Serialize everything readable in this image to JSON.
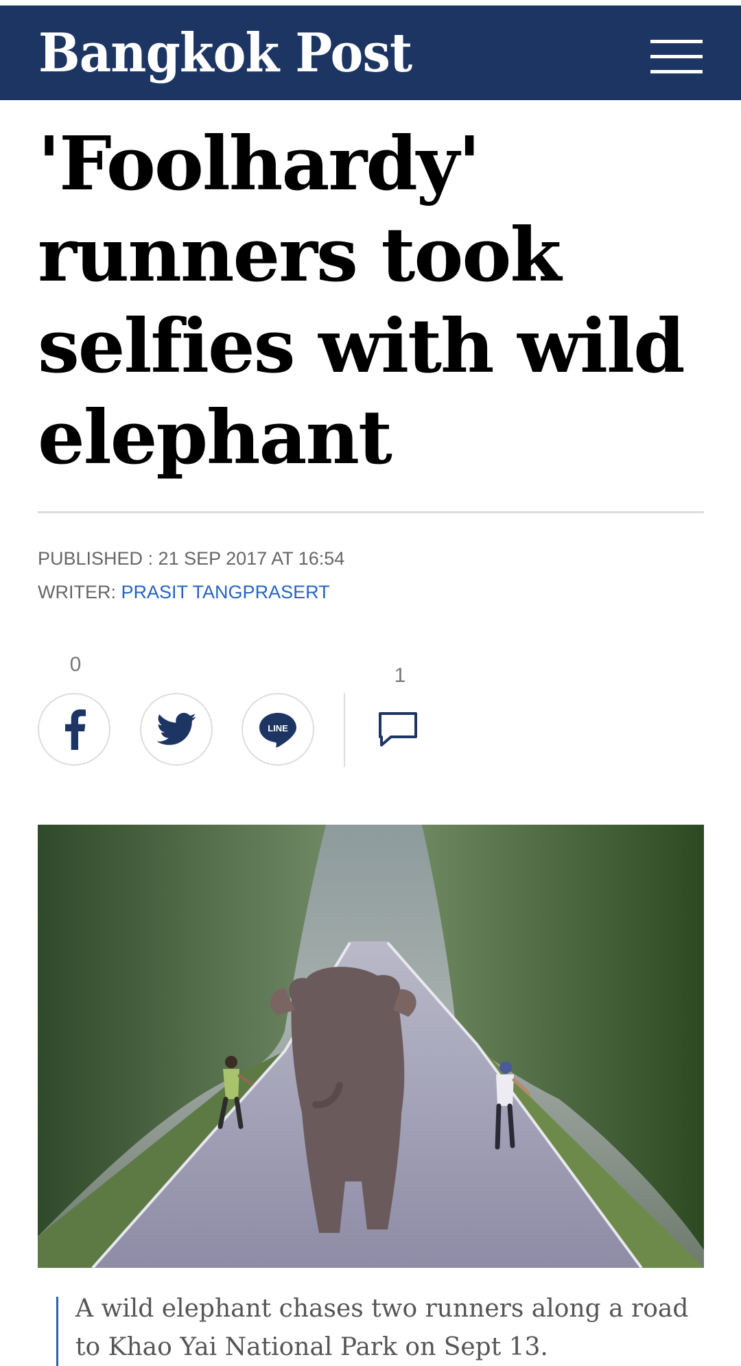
{
  "header": {
    "logo_text": "Bangkok Post",
    "menu_icon": "hamburger-menu-icon",
    "background_color": "#1c3563"
  },
  "article": {
    "headline_lines": [
      "'Foolhardy'",
      "runners took",
      "selfies with wild",
      "elephant"
    ],
    "published": "PUBLISHED : 21 SEP 2017 AT 16:54",
    "writer_label": "WRITER:",
    "writer_name": "PRASIT TANGPRASERT"
  },
  "share": {
    "share_count": "0",
    "comment_count": "1",
    "buttons": [
      {
        "name": "facebook-share-button",
        "icon": "facebook-icon"
      },
      {
        "name": "twitter-share-button",
        "icon": "twitter-icon"
      },
      {
        "name": "line-share-button",
        "icon": "line-icon",
        "label": "LINE"
      }
    ],
    "comment_icon": "comment-bubble-icon"
  },
  "photo": {
    "caption": "A wild elephant chases two runners along a road to Khao Yai National Park on Sept 13."
  },
  "colors": {
    "header_bg": "#1c3563",
    "link": "#2563c4",
    "caption_bar": "#2d5fb5"
  }
}
